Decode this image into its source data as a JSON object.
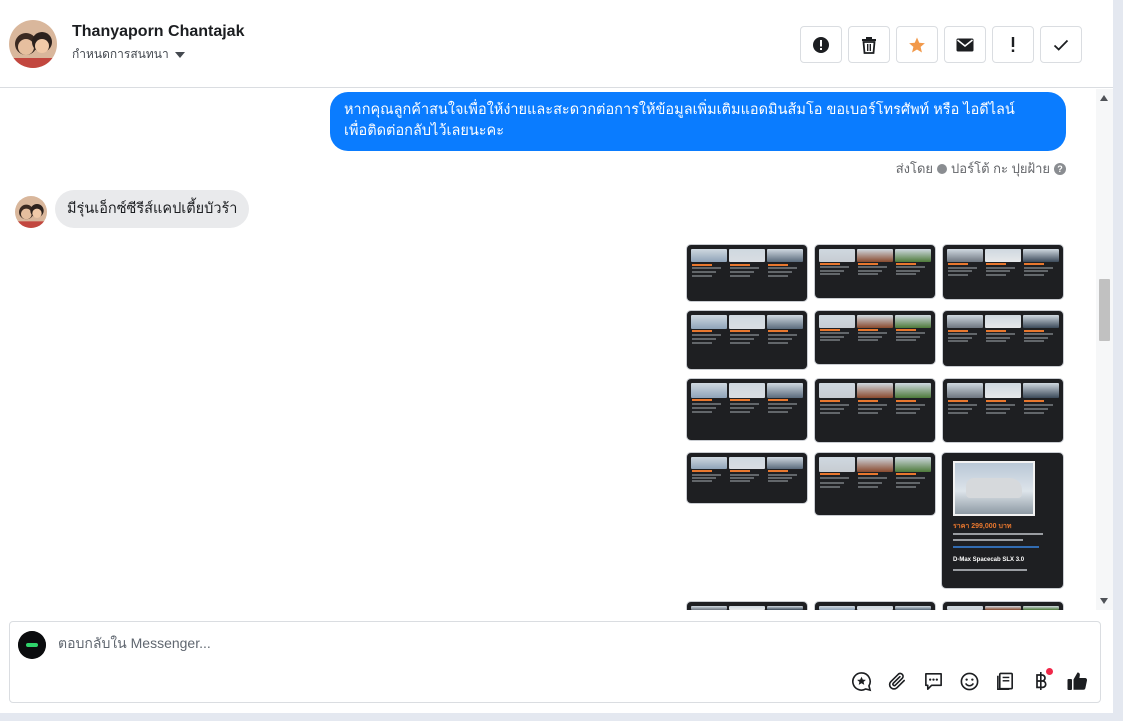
{
  "header": {
    "contact_name": "Thanyaporn Chantajak",
    "assign_label": "กำหนดการสนทนา",
    "actions": [
      {
        "name": "report-spam-button",
        "icon": "alert-circle-icon"
      },
      {
        "name": "delete-button",
        "icon": "trash-icon"
      },
      {
        "name": "star-button",
        "icon": "star-icon"
      },
      {
        "name": "mark-unread-button",
        "icon": "envelope-icon"
      },
      {
        "name": "follow-up-button",
        "icon": "exclamation-icon"
      },
      {
        "name": "mark-done-button",
        "icon": "checkmark-icon"
      }
    ]
  },
  "thread": {
    "outgoing_message": {
      "line1": "หากคุณลูกค้าสนใจเพื่อให้ง่ายและสะดวกต่อการให้ข้อมูลเพิ่มเติมแอดมินส้มโอ ขอเบอร์โทรศัพท์ หรือ ไอดีไลน์",
      "line2": "เพื่อติดต่อกลับไว้เลยนะคะ"
    },
    "sent_by_label": "ส่งโดย",
    "sent_by_name": "ปอร์โต้ กะ ปุยฝ้าย",
    "incoming_message": "มีรุ่นเอ็กซ์ซีรีส์แคปเตี้ยบัวร้า",
    "featured_card": {
      "price": "ราคา 299,000 บาท",
      "model": "D-Max Spacecab SLX 3.0"
    }
  },
  "composer": {
    "placeholder": "ตอบกลับใน Messenger...",
    "tools": [
      "saved-reply-icon",
      "attachment-icon",
      "chat-bubble-icon",
      "emoji-icon",
      "book-icon",
      "baht-icon",
      "thumbs-up-icon"
    ]
  },
  "colors": {
    "accent": "#0a7cff",
    "star": "#f2994a",
    "notification": "#f02849"
  }
}
